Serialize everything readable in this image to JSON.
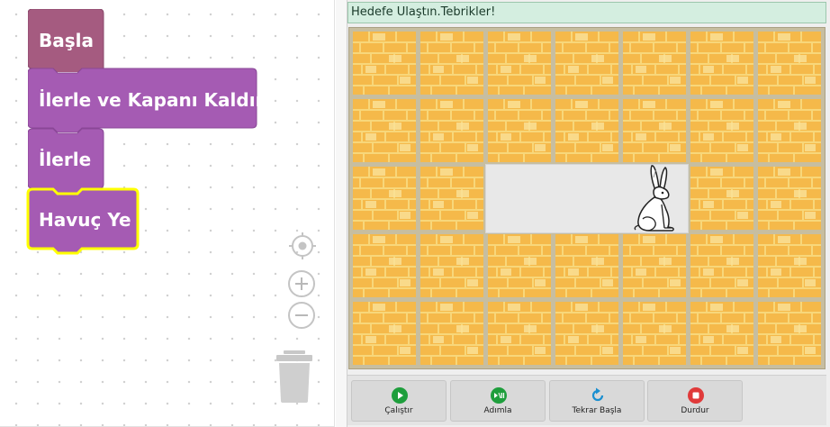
{
  "workspace": {
    "blocks": [
      {
        "label": "Başla",
        "color": "#a55b80"
      },
      {
        "label": "İlerle ve Kapanı Kaldır",
        "color": "#a55bb3"
      },
      {
        "label": "İlerle",
        "color": "#a55bb3"
      },
      {
        "label": "Havuç Ye",
        "color": "#a55bb3",
        "highlight": "#ffff00"
      }
    ],
    "controls": {
      "center_icon": "crosshair-icon",
      "zoom_in_icon": "plus-icon",
      "zoom_out_icon": "minus-icon",
      "trash_icon": "trash-icon"
    }
  },
  "stage": {
    "status_message": "Hedefe Ulaştın.Tebrikler!",
    "grid": {
      "columns": 7,
      "rows": 5,
      "open_cells": [
        [
          2,
          2
        ],
        [
          3,
          2
        ],
        [
          4,
          2
        ]
      ]
    },
    "character_icon": "rabbit-icon",
    "wall_tile_color": "#f5b94a",
    "floor_color": "#e8e8e8"
  },
  "buttons": {
    "run": {
      "label": "Çalıştır",
      "icon": "play-icon",
      "color": "#1e9e3c"
    },
    "step": {
      "label": "Adımla",
      "icon": "step-icon",
      "color": "#1e9e3c"
    },
    "reset": {
      "label": "Tekrar Başla",
      "icon": "restart-icon",
      "color": "#1a8fd0"
    },
    "stop": {
      "label": "Durdur",
      "icon": "stop-icon",
      "color": "#e03a3a"
    }
  }
}
